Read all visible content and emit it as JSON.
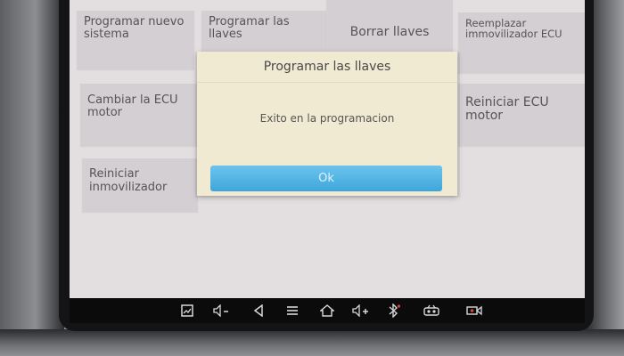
{
  "tiles": {
    "program_new_system": "Programar nuevo sistema",
    "program_keys": "Programar las llaves",
    "delete_keys": "Borrar llaves",
    "replace_immobilizer": "Reemplazar immovilizador ECU",
    "change_ecu": "Cambiar la ECU motor",
    "restart_ecu": "Reiniciar ECU motor",
    "restart_immobilizer": "Reiniciar inmovilizador"
  },
  "dialog": {
    "title": "Programar las llaves",
    "message": "Exito en la programacion",
    "ok_label": "Ok"
  },
  "navbar": {
    "icons": [
      "screenshot-icon",
      "volume-down-icon",
      "back-icon",
      "menu-icon",
      "home-icon",
      "volume-up-icon",
      "bluetooth-icon",
      "vci-icon",
      "screen-record-icon"
    ]
  },
  "colors": {
    "screen_background": "#e3dfe1",
    "tile_background": "#d3cfd2",
    "dialog_background": "#f1ead3",
    "ok_button": "#4db3e3",
    "navbar": "#0b0b0c"
  }
}
